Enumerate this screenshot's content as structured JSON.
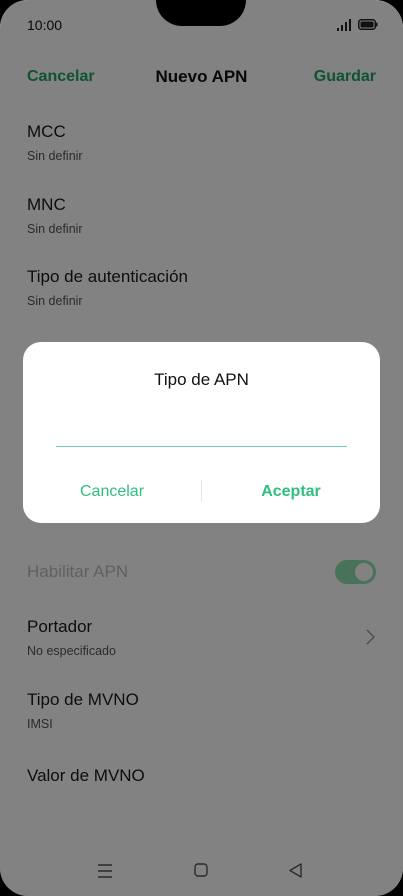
{
  "status_bar": {
    "time": "10:00",
    "icons": [
      "signal-icon",
      "battery-icon"
    ]
  },
  "header": {
    "cancel_label": "Cancelar",
    "title": "Nuevo APN",
    "save_label": "Guardar"
  },
  "fields": {
    "mcc": {
      "label": "MCC",
      "value": "Sin definir"
    },
    "mnc": {
      "label": "MNC",
      "value": "Sin definir"
    },
    "auth_type": {
      "label": "Tipo de autenticación",
      "value": "Sin definir"
    },
    "enable_apn": {
      "label": "Habilitar APN",
      "enabled": true
    },
    "bearer": {
      "label": "Portador",
      "value": "No especificado"
    },
    "mvno_type": {
      "label": "Tipo de MVNO",
      "value": "IMSI"
    },
    "mvno_value": {
      "label": "Valor de MVNO"
    }
  },
  "dialog": {
    "title": "Tipo de APN",
    "input_value": "",
    "cancel_label": "Cancelar",
    "accept_label": "Aceptar"
  },
  "nav_bar": {
    "icons": [
      "menu-icon",
      "home-icon",
      "back-icon"
    ]
  },
  "colors": {
    "accent": "#1fa361",
    "dialog_accent": "#2fbf7f",
    "toggle_on": "#8fe0b1"
  }
}
